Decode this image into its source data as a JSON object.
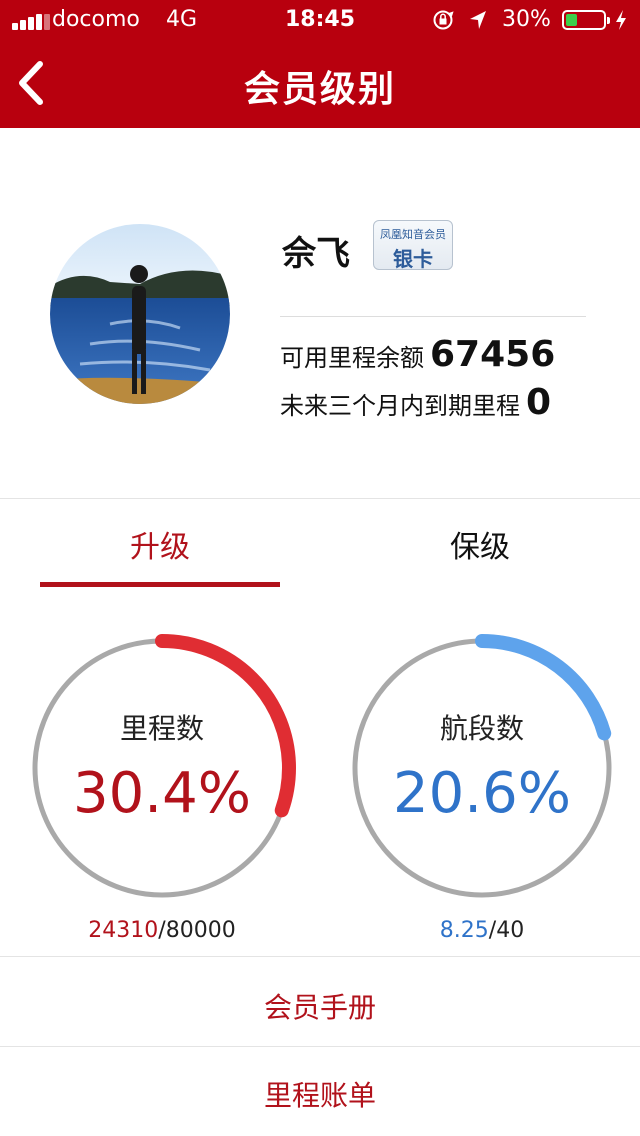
{
  "status_bar": {
    "carrier": "docomo",
    "network": "4G",
    "time": "18:45",
    "battery_percent": "30%",
    "battery_level": 0.3
  },
  "nav": {
    "title": "会员级别",
    "back_icon": "chevron-left-icon"
  },
  "profile": {
    "name": "佘飞",
    "tier_program": "凤凰知音会员",
    "tier_card": "银卡",
    "available_miles_label": "可用里程余额",
    "available_miles": "67456",
    "expiring_label": "未来三个月内到期里程",
    "expiring_miles": "0"
  },
  "tabs": [
    {
      "label": "升级",
      "active": true
    },
    {
      "label": "保级",
      "active": false
    }
  ],
  "progress": {
    "miles": {
      "label": "里程数",
      "percent_text": "30.4%",
      "fraction": 0.304,
      "current": "24310",
      "target": "/80000",
      "color": "#e02d33"
    },
    "segments": {
      "label": "航段数",
      "percent_text": "20.6%",
      "fraction": 0.206,
      "current": "8.25",
      "target": "/40",
      "color": "#5ea3ec"
    },
    "track_color": "#a9a9a9"
  },
  "links": {
    "handbook": "会员手册",
    "statement": "里程账单"
  },
  "colors": {
    "brand": "#b8000e",
    "accent_red": "#b1121b",
    "accent_blue": "#2f73c9"
  }
}
